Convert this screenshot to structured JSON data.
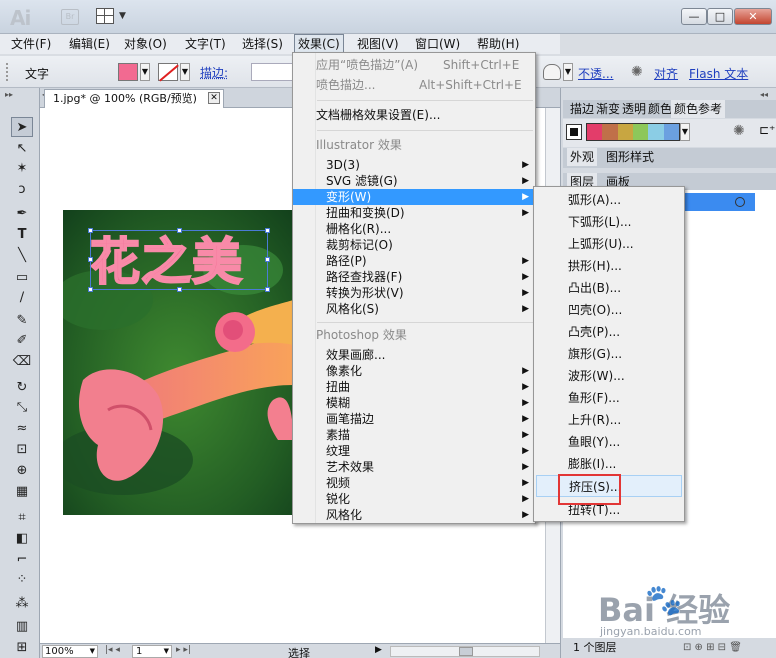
{
  "app": {
    "logo_ai": "Ai",
    "logo_br": "Br"
  },
  "menubar": [
    {
      "label": "文件(F)"
    },
    {
      "label": "编辑(E)"
    },
    {
      "label": "对象(O)"
    },
    {
      "label": "文字(T)"
    },
    {
      "label": "选择(S)"
    },
    {
      "label": "效果(C)"
    },
    {
      "label": "视图(V)"
    },
    {
      "label": "窗口(W)"
    },
    {
      "label": "帮助(H)"
    }
  ],
  "control": {
    "tool_label": "文字",
    "stroke_label": "描边:",
    "opacity_label": "不透...",
    "align_label": "对齐",
    "flash_label": "Flash 文本"
  },
  "document": {
    "tab_title": "1.jpg* @ 100% (RGB/预览)",
    "artwork_text": "花之美"
  },
  "status": {
    "zoom": "100%",
    "page": "1",
    "mode": "选择"
  },
  "panels": {
    "row1_tabs": [
      "描边",
      "渐变",
      "透明",
      "颜色",
      "颜色参考"
    ],
    "row2_tabs": [
      "外观",
      "图形样式"
    ],
    "row3_tabs": [
      "图层",
      "画板"
    ],
    "layer_count": "1 个图层",
    "guide_colors": [
      "#e33d6a",
      "#c07049",
      "#c8a641",
      "#8dc75a",
      "#8bcde5",
      "#6ba0e0"
    ]
  },
  "effect_menu": {
    "apply_label": "应用“喷色描边”(A)",
    "apply_shortcut": "Shift+Ctrl+E",
    "last_label": "喷色描边...",
    "last_shortcut": "Alt+Shift+Ctrl+E",
    "raster_settings": "文档栅格效果设置(E)...",
    "illustrator_header": "Illustrator 效果",
    "illustrator_items": [
      "3D(3)",
      "SVG 滤镜(G)",
      "变形(W)",
      "扭曲和变换(D)",
      "栅格化(R)...",
      "裁剪标记(O)",
      "路径(P)",
      "路径查找器(F)",
      "转换为形状(V)",
      "风格化(S)"
    ],
    "photoshop_header": "Photoshop 效果",
    "photoshop_items": [
      "效果画廊...",
      "像素化",
      "扭曲",
      "模糊",
      "画笔描边",
      "素描",
      "纹理",
      "艺术效果",
      "视频",
      "锐化",
      "风格化"
    ]
  },
  "warp_menu": {
    "items": [
      "弧形(A)...",
      "下弧形(L)...",
      "上弧形(U)...",
      "拱形(H)...",
      "凸出(B)...",
      "凹壳(O)...",
      "凸壳(P)...",
      "旗形(G)...",
      "波形(W)...",
      "鱼形(F)...",
      "上升(R)...",
      "鱼眼(Y)...",
      "膨胀(I)...",
      "挤压(S)...",
      "扭转(T)..."
    ]
  },
  "watermark": {
    "brand": "Bai  经验",
    "url": "jingyan.baidu.com"
  },
  "colors": {
    "fill": "#f26a91",
    "highlight": "#3399ff",
    "annotation": "#e23636"
  }
}
